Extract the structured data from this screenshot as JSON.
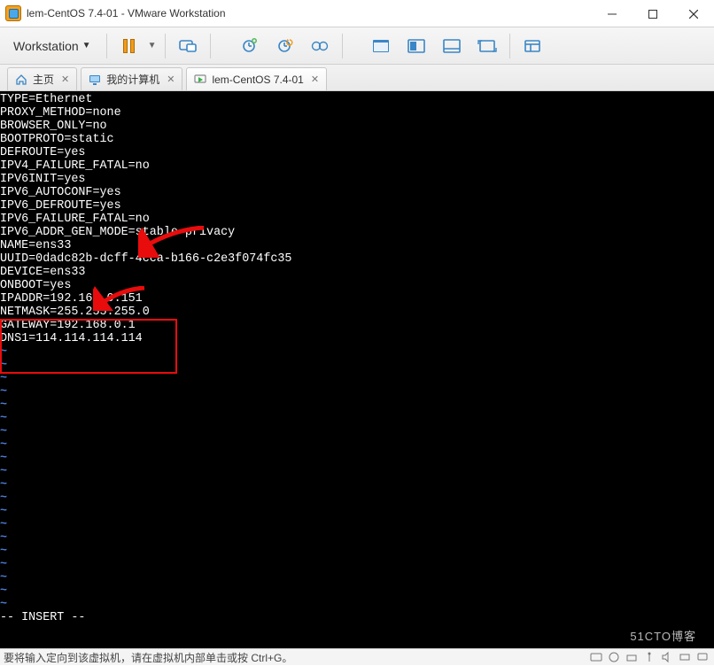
{
  "window": {
    "title": "lem-CentOS 7.4-01 - VMware Workstation"
  },
  "menu": {
    "workstation_label": "Workstation"
  },
  "tabs": [
    {
      "label": "主页",
      "kind": "home"
    },
    {
      "label": "我的计算机",
      "kind": "pc"
    },
    {
      "label": "lem-CentOS 7.4-01",
      "kind": "console"
    }
  ],
  "terminal": {
    "config_lines": [
      "TYPE=Ethernet",
      "PROXY_METHOD=none",
      "BROWSER_ONLY=no",
      "BOOTPROTO=static",
      "DEFROUTE=yes",
      "IPV4_FAILURE_FATAL=no",
      "IPV6INIT=yes",
      "IPV6_AUTOCONF=yes",
      "IPV6_DEFROUTE=yes",
      "IPV6_FAILURE_FATAL=no",
      "IPV6_ADDR_GEN_MODE=stable-privacy",
      "NAME=ens33",
      "UUID=0dadc82b-dcff-4cca-b166-c2e3f074fc35",
      "DEVICE=ens33",
      "ONBOOT=yes",
      "IPADDR=192.168.0.151",
      "NETMASK=255.255.255.0",
      "GATEWAY=192.168.0.1",
      "DNS1=114.114.114.114"
    ],
    "mode_line": "-- INSERT --"
  },
  "status": {
    "text": "要将输入定向到该虚拟机，请在虚拟机内部单击或按 Ctrl+G。"
  },
  "watermark": "51CTO博客"
}
